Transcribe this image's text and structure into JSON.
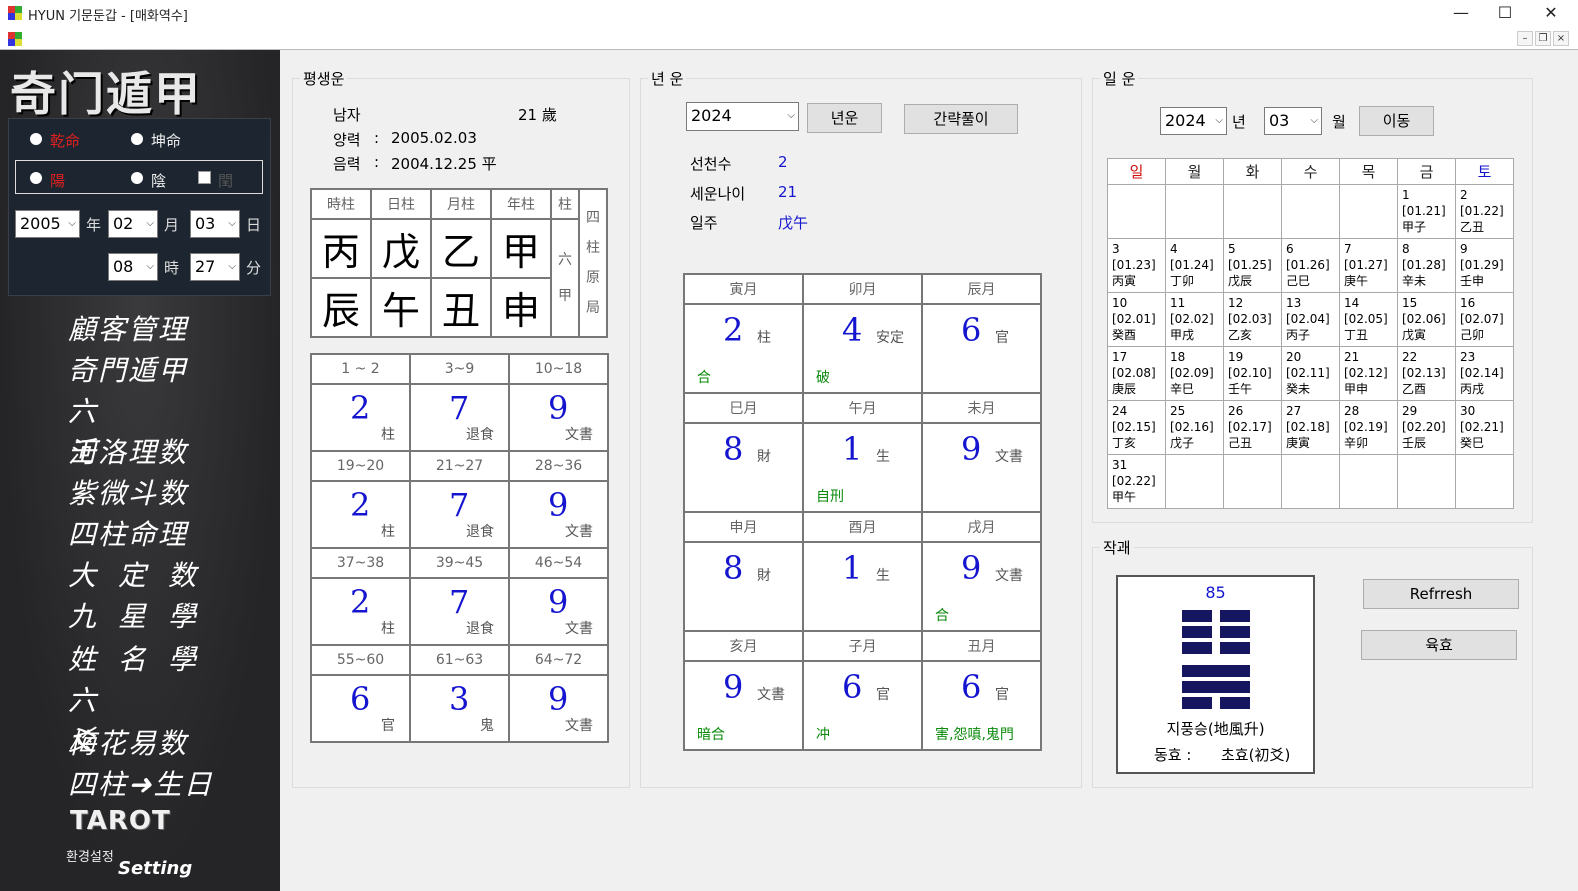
{
  "window": {
    "title": "HYUN 기문둔갑 - [매화역수]",
    "minimize": "—",
    "maximize": "☐",
    "close": "✕"
  },
  "mdi": {
    "min": "–",
    "restore": "❐",
    "close": "×"
  },
  "sidebar": {
    "logo": "奇门遁甲",
    "gender": {
      "male": "乾命",
      "female": "坤命",
      "selected": "male"
    },
    "yinyang": {
      "yang": "陽",
      "yin": "陰",
      "leap": "閏",
      "selected": "yang"
    },
    "date": {
      "year": "2005",
      "year_unit": "年",
      "month": "02",
      "month_unit": "月",
      "day": "03",
      "day_unit": "日",
      "hour": "08",
      "hour_unit": "時",
      "minute": "27",
      "minute_unit": "分"
    },
    "menu": [
      "顧客管理",
      "奇門遁甲",
      "六壬",
      "河洛理数",
      "紫微斗数",
      "四柱命理",
      "大定数",
      "九星學",
      "姓名學",
      "六爻",
      "梅花易数",
      "四柱➜生日"
    ],
    "tarot": "TAROT",
    "setting_label": "환경설정",
    "setting": "Setting"
  },
  "lifetime": {
    "title": "평생운",
    "gender": "남자",
    "age": "21 歲",
    "solar_label": "양력",
    "solar_value": "2005.02.03",
    "lunar_label": "음력",
    "lunar_value": "2004.12.25 平",
    "colon": ":",
    "pillar_headers": [
      "時柱",
      "日柱",
      "月柱",
      "年柱",
      "柱"
    ],
    "stems": [
      "丙",
      "戊",
      "乙",
      "甲"
    ],
    "branches": [
      "辰",
      "午",
      "丑",
      "申"
    ],
    "liujia": "六甲",
    "four_pillars": "四柱原局",
    "periods": [
      {
        "range": "1 ~ 2",
        "num": "2",
        "label": "柱"
      },
      {
        "range": "3~9",
        "num": "7",
        "label": "退食"
      },
      {
        "range": "10~18",
        "num": "9",
        "label": "文書"
      },
      {
        "range": "19~20",
        "num": "2",
        "label": "柱"
      },
      {
        "range": "21~27",
        "num": "7",
        "label": "退食"
      },
      {
        "range": "28~36",
        "num": "9",
        "label": "文書"
      },
      {
        "range": "37~38",
        "num": "2",
        "label": "柱"
      },
      {
        "range": "39~45",
        "num": "7",
        "label": "退食"
      },
      {
        "range": "46~54",
        "num": "9",
        "label": "文書"
      },
      {
        "range": "55~60",
        "num": "6",
        "label": "官"
      },
      {
        "range": "61~63",
        "num": "3",
        "label": "鬼"
      },
      {
        "range": "64~72",
        "num": "9",
        "label": "文書"
      }
    ]
  },
  "yearly": {
    "title": "년 운",
    "year": "2024",
    "btn_year": "년운",
    "btn_brief": "간략풀이",
    "rows": [
      {
        "label": "선천수",
        "value": "2"
      },
      {
        "label": "세운나이",
        "value": "21"
      },
      {
        "label": "일주",
        "value": "戊午"
      }
    ],
    "months": [
      {
        "month": "寅月",
        "num": "2",
        "label": "柱",
        "note": "合"
      },
      {
        "month": "卯月",
        "num": "4",
        "label": "安定",
        "note": "破"
      },
      {
        "month": "辰月",
        "num": "6",
        "label": "官",
        "note": ""
      },
      {
        "month": "巳月",
        "num": "8",
        "label": "財",
        "note": ""
      },
      {
        "month": "午月",
        "num": "1",
        "label": "生",
        "note": "自刑"
      },
      {
        "month": "未月",
        "num": "9",
        "label": "文書",
        "note": ""
      },
      {
        "month": "申月",
        "num": "8",
        "label": "財",
        "note": ""
      },
      {
        "month": "酉月",
        "num": "1",
        "label": "生",
        "note": ""
      },
      {
        "month": "戌月",
        "num": "9",
        "label": "文書",
        "note": "合"
      },
      {
        "month": "亥月",
        "num": "9",
        "label": "文書",
        "note": "暗合"
      },
      {
        "month": "子月",
        "num": "6",
        "label": "官",
        "note": "冲"
      },
      {
        "month": "丑月",
        "num": "6",
        "label": "官",
        "note": "害,怨嗔,鬼門"
      }
    ]
  },
  "daily": {
    "title": "일 운",
    "year": "2024",
    "year_unit": "년",
    "month": "03",
    "month_unit": "월",
    "btn_move": "이동",
    "weekdays": [
      "일",
      "월",
      "화",
      "수",
      "목",
      "금",
      "토"
    ],
    "weekday_colors": [
      "#d01010",
      "#222222",
      "#222222",
      "#222222",
      "#222222",
      "#222222",
      "#1515d0"
    ],
    "weeks": [
      [
        null,
        null,
        null,
        null,
        null,
        {
          "d": "1",
          "l": "[01.21]",
          "g": "甲子"
        },
        {
          "d": "2",
          "l": "[01.22]",
          "g": "乙丑"
        }
      ],
      [
        {
          "d": "3",
          "l": "[01.23]",
          "g": "丙寅"
        },
        {
          "d": "4",
          "l": "[01.24]",
          "g": "丁卯"
        },
        {
          "d": "5",
          "l": "[01.25]",
          "g": "戊辰"
        },
        {
          "d": "6",
          "l": "[01.26]",
          "g": "己巳"
        },
        {
          "d": "7",
          "l": "[01.27]",
          "g": "庚午"
        },
        {
          "d": "8",
          "l": "[01.28]",
          "g": "辛未"
        },
        {
          "d": "9",
          "l": "[01.29]",
          "g": "壬申"
        }
      ],
      [
        {
          "d": "10",
          "l": "[02.01]",
          "g": "癸酉"
        },
        {
          "d": "11",
          "l": "[02.02]",
          "g": "甲戌"
        },
        {
          "d": "12",
          "l": "[02.03]",
          "g": "乙亥"
        },
        {
          "d": "13",
          "l": "[02.04]",
          "g": "丙子"
        },
        {
          "d": "14",
          "l": "[02.05]",
          "g": "丁丑"
        },
        {
          "d": "15",
          "l": "[02.06]",
          "g": "戊寅"
        },
        {
          "d": "16",
          "l": "[02.07]",
          "g": "己卯"
        }
      ],
      [
        {
          "d": "17",
          "l": "[02.08]",
          "g": "庚辰"
        },
        {
          "d": "18",
          "l": "[02.09]",
          "g": "辛巳"
        },
        {
          "d": "19",
          "l": "[02.10]",
          "g": "壬午"
        },
        {
          "d": "20",
          "l": "[02.11]",
          "g": "癸未"
        },
        {
          "d": "21",
          "l": "[02.12]",
          "g": "甲申"
        },
        {
          "d": "22",
          "l": "[02.13]",
          "g": "乙酉"
        },
        {
          "d": "23",
          "l": "[02.14]",
          "g": "丙戌"
        }
      ],
      [
        {
          "d": "24",
          "l": "[02.15]",
          "g": "丁亥"
        },
        {
          "d": "25",
          "l": "[02.16]",
          "g": "戊子"
        },
        {
          "d": "26",
          "l": "[02.17]",
          "g": "己丑"
        },
        {
          "d": "27",
          "l": "[02.18]",
          "g": "庚寅"
        },
        {
          "d": "28",
          "l": "[02.19]",
          "g": "辛卯"
        },
        {
          "d": "29",
          "l": "[02.20]",
          "g": "壬辰"
        },
        {
          "d": "30",
          "l": "[02.21]",
          "g": "癸巳"
        }
      ],
      [
        {
          "d": "31",
          "l": "[02.22]",
          "g": "甲午"
        },
        null,
        null,
        null,
        null,
        null,
        null
      ]
    ]
  },
  "hexagram": {
    "title": "작괘",
    "number": "85",
    "lines": [
      "yin",
      "yin",
      "yin",
      "yang",
      "yang",
      "yin"
    ],
    "name": "지풍승(地風升)",
    "moving_label": "동효 :",
    "moving_value": "초효(初爻)",
    "btn_refresh": "Refrresh",
    "btn_yao": "육효"
  },
  "colors": {
    "accent_blue": "#1515d0",
    "note_green": "#0a8a0a",
    "sidebar_bg": "#2b2b2d",
    "male_red": "#e02020"
  }
}
